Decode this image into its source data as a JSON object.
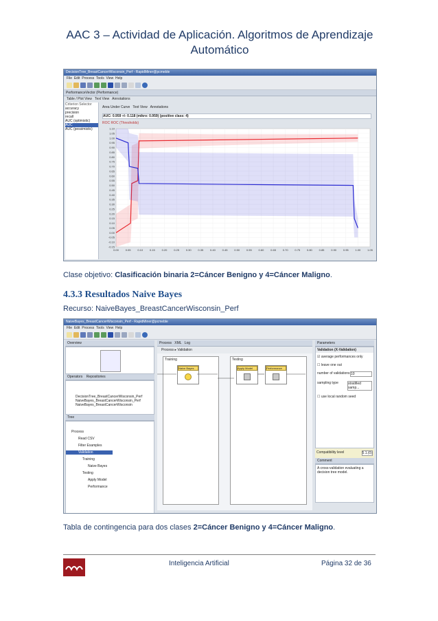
{
  "header": {
    "title": "AAC 3 – Actividad de Aplicación. Algoritmos de Aprendizaje Automático"
  },
  "screenshot1": {
    "window_title": "DecisionTree_BreastCancerWisconsin_Perf - RapidMiner@pcmeble",
    "menu": [
      "File",
      "Edit",
      "Process",
      "Tools",
      "View",
      "Help"
    ],
    "panel_title": "PerformanceVector (Performance)",
    "view_options": [
      "Table / Plot View",
      "Text View",
      "Annotations"
    ],
    "criterion_label": "Criterion Selector",
    "criteria": [
      "accuracy",
      "precision",
      "recall",
      "AUC (optimistic)",
      "AUC",
      "AUC (pessimistic)"
    ],
    "sub_view_options": [
      "Area Under Curve",
      "Text View",
      "Annotations"
    ],
    "auc_text": "AUC: 0.959 +/- 0.118 (mikro: 0.959) (positive class: 4)",
    "legend": "ROC  ROC (Thresholds)",
    "accent_red": "#e8292f",
    "accent_blue": "#2b2bd1"
  },
  "chart_data": {
    "type": "line",
    "ylim": [
      -0.15,
      1.1
    ],
    "xlim": [
      0.0,
      1.05
    ],
    "yticks": [
      "1.10",
      "1.05",
      "1.00",
      "0.95",
      "0.90",
      "0.85",
      "0.80",
      "0.75",
      "0.70",
      "0.65",
      "0.60",
      "0.55",
      "0.50",
      "0.45",
      "0.40",
      "0.35",
      "0.30",
      "0.25",
      "0.20",
      "0.15",
      "0.10",
      "0.05",
      "0.00",
      "-0.05",
      "-0.10",
      "-0.15"
    ],
    "xticks": [
      "0.00",
      "0.05",
      "0.10",
      "0.15",
      "0.20",
      "0.25",
      "0.30",
      "0.35",
      "0.40",
      "0.45",
      "0.50",
      "0.55",
      "0.60",
      "0.65",
      "0.70",
      "0.75",
      "0.80",
      "0.85",
      "0.90",
      "0.95",
      "1.00",
      "1.05"
    ],
    "series": [
      {
        "color": "#e8292f",
        "x": [
          0.0,
          0.06,
          0.065,
          0.09,
          0.095,
          0.4,
          0.7,
          1.0
        ],
        "y": [
          0.0,
          0.1,
          0.52,
          0.55,
          0.97,
          0.98,
          0.99,
          1.0
        ],
        "band": [
          0.2,
          0.2,
          0.4,
          0.4,
          0.08,
          0.06,
          0.05,
          0.04
        ]
      },
      {
        "color": "#2b2bd1",
        "x": [
          0.0,
          0.05,
          0.055,
          0.09,
          0.095,
          0.5,
          0.98,
          0.985,
          1.0
        ],
        "y": [
          1.0,
          0.95,
          0.7,
          0.68,
          0.52,
          0.51,
          0.5,
          0.15,
          0.05
        ],
        "band": [
          0.1,
          0.2,
          0.35,
          0.35,
          0.33,
          0.33,
          0.33,
          0.2,
          0.1
        ]
      }
    ]
  },
  "caption1": {
    "prefix": "Clase objetivo: ",
    "bold": "Clasificación binaria 2=Cáncer Benigno y 4=Cáncer Maligno",
    "suffix": "."
  },
  "section": {
    "heading": "4.3.3 Resultados Naive Bayes",
    "resource": "Recurso: NaiveBayes_BreastCancerWisconsin_Perf"
  },
  "screenshot2": {
    "window_title": "NaiveBayes_BreastCancerWisconsin_Perf - RapidMiner@pcmeble",
    "menu": [
      "File",
      "Edit",
      "Process",
      "Tools",
      "View",
      "Help"
    ],
    "overview_title": "Overview",
    "operators_tab": "Operators",
    "repositories_tab": "Repositories",
    "operator_items": [
      "DecisionTree_BreastCancerWisconsin_Perf",
      "NaiveBayes_BreastCancerWisconsin_Perf",
      "NaiveBayes_BreastCancerWisconsin"
    ],
    "tree_title": "Tree",
    "tree_items": [
      "Process",
      "Read CSV",
      "Filter Examples",
      "Validation",
      "Training",
      "Naive Bayes",
      "Testing",
      "Apply Model",
      "Performance"
    ],
    "process_tab": "Process",
    "xml_tab": "XML",
    "log_tab": "Log",
    "breadcrumb": [
      "Process",
      "Validation"
    ],
    "training_label": "Training",
    "testing_label": "Testing",
    "op_naive": "Naive Bayes",
    "op_apply": "Apply Model",
    "op_perf": "Performance",
    "params_title": "Parameters",
    "params_header": "Validation (X-Validation)",
    "param_average": "average performances only",
    "param_leave": "leave one out",
    "param_folds_label": "number of validations",
    "param_folds_value": "10",
    "param_sampling_label": "sampling type",
    "param_sampling_value": "stratified samp...",
    "param_seed": "use local random seed",
    "compat_label": "Compatibility level",
    "compat_value": "5.1.(0)",
    "comment_title": "Comment",
    "comment_text": "A cross-validation evaluating a decision tree model."
  },
  "caption2": {
    "prefix": "Tabla de contingencia para dos clases ",
    "bold": "2=Cáncer Benigno y 4=Cáncer Maligno",
    "suffix": "."
  },
  "footer": {
    "center": "Inteligencia Artificial",
    "page": "Página 32 de 36",
    "logo_color": "#9e1a20"
  }
}
